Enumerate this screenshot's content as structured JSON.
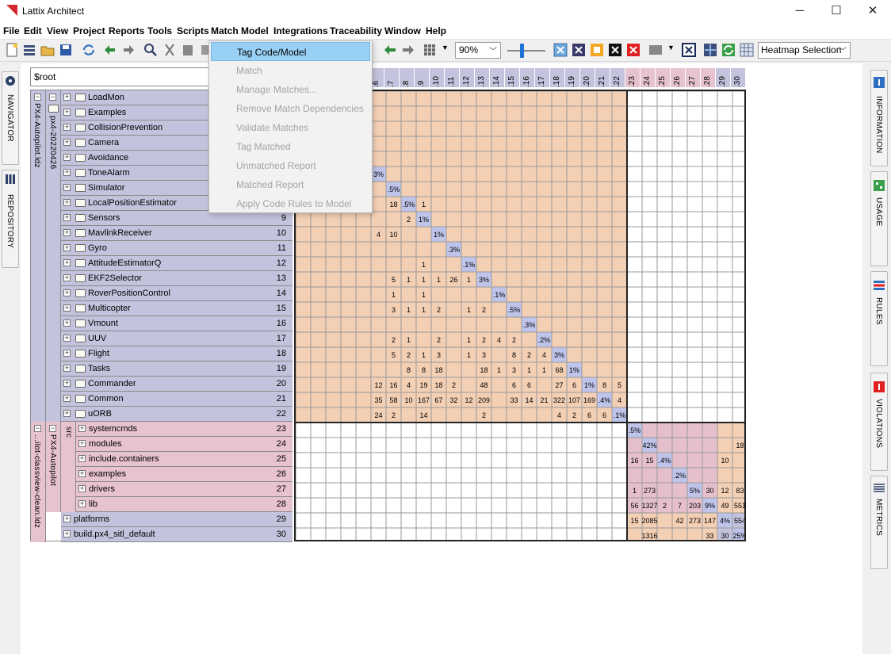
{
  "window": {
    "title": "Lattix Architect",
    "minimize": "─",
    "maximize": "☐",
    "close": "✕"
  },
  "menu": [
    "File",
    "Edit",
    "View",
    "Project",
    "Reports",
    "Tools",
    "Scripts",
    "Match Model",
    "Integrations",
    "Traceability",
    "Window",
    "Help"
  ],
  "toolbar": {
    "zoom_value": "90%",
    "heatmap_value": "Heatmap Selection"
  },
  "search": {
    "value": "$root"
  },
  "left_tabs": [
    "NAVIGATOR",
    "REPOSITORY"
  ],
  "right_tabs": [
    "INFORMATION",
    "USAGE",
    "RULES",
    "VIOLATIONS",
    "METRICS"
  ],
  "dropdown": {
    "items": [
      {
        "label": "Tag Code/Model",
        "enabled": true
      },
      {
        "label": "Match",
        "enabled": false
      },
      {
        "label": "Manage Matches...",
        "enabled": false
      },
      {
        "label": "Remove Match Dependencies",
        "enabled": false
      },
      {
        "label": "Validate Matches",
        "enabled": false
      },
      {
        "label": "Tag Matched",
        "enabled": false
      },
      {
        "label": "Unmatched Report",
        "enabled": false
      },
      {
        "label": "Matched Report",
        "enabled": false
      },
      {
        "label": "Apply Code Rules to Model",
        "enabled": false
      }
    ]
  },
  "groups": [
    {
      "label": "PX4-Autopilot.ldz"
    },
    {
      "label": "px4-20220426"
    },
    {
      "label": "...ilot-classview-clean.ldz"
    },
    {
      "label": "PX4-Autopilot"
    },
    {
      "label": "src"
    }
  ],
  "rows": [
    {
      "name": "LoadMon",
      "num": "1"
    },
    {
      "name": "Examples",
      "num": "2"
    },
    {
      "name": "CollisionPrevention",
      "num": "3"
    },
    {
      "name": "Camera",
      "num": "4"
    },
    {
      "name": "Avoidance",
      "num": "5"
    },
    {
      "name": "ToneAlarm",
      "num": "6"
    },
    {
      "name": "Simulator",
      "num": "7"
    },
    {
      "name": "LocalPositionEstimator",
      "num": "8"
    },
    {
      "name": "Sensors",
      "num": "9"
    },
    {
      "name": "MavlinkReceiver",
      "num": "10"
    },
    {
      "name": "Gyro",
      "num": "11"
    },
    {
      "name": "AttitudeEstimatorQ",
      "num": "12"
    },
    {
      "name": "EKF2Selector",
      "num": "13"
    },
    {
      "name": "RoverPositionControl",
      "num": "14"
    },
    {
      "name": "Multicopter",
      "num": "15"
    },
    {
      "name": "Vmount",
      "num": "16"
    },
    {
      "name": "UUV",
      "num": "17"
    },
    {
      "name": "Flight",
      "num": "18"
    },
    {
      "name": "Tasks",
      "num": "19"
    },
    {
      "name": "Commander",
      "num": "20"
    },
    {
      "name": "Common",
      "num": "21"
    },
    {
      "name": "uORB",
      "num": "22"
    },
    {
      "name": "systemcmds",
      "num": "23"
    },
    {
      "name": "modules",
      "num": "24"
    },
    {
      "name": "include.containers",
      "num": "25"
    },
    {
      "name": "examples",
      "num": "26"
    },
    {
      "name": "drivers",
      "num": "27"
    },
    {
      "name": "lib",
      "num": "28"
    },
    {
      "name": "platforms",
      "num": "29"
    },
    {
      "name": "build.px4_sitl_default",
      "num": "30"
    }
  ],
  "col_headers": [
    ".6",
    ".7",
    ".8",
    ".9",
    ".10",
    ".11",
    ".12",
    ".13",
    ".14",
    ".15",
    ".16",
    ".17",
    ".18",
    ".19",
    ".20",
    ".21",
    ".22",
    ".23",
    ".24",
    ".25",
    ".26",
    ".27",
    ".28",
    ".29",
    ".30"
  ],
  "colors": {
    "orange_block": "#f3cfb4",
    "purple_block": "#c3c3dd",
    "pink_block": "#e5c0cc",
    "diag": "#bfc5ea",
    "group1": "#c3c3dd",
    "group2": "#e7c2cf",
    "selected_menu": "#99d1f6"
  },
  "cells": [
    [
      6,
      6,
      "3%"
    ],
    [
      7,
      7,
      ".5%"
    ],
    [
      8,
      7,
      "18"
    ],
    [
      8,
      8,
      ".5%"
    ],
    [
      8,
      9,
      "1"
    ],
    [
      9,
      8,
      "2"
    ],
    [
      9,
      9,
      "1%"
    ],
    [
      10,
      6,
      "4"
    ],
    [
      10,
      7,
      "10"
    ],
    [
      10,
      10,
      "1%"
    ],
    [
      11,
      11,
      ".3%"
    ],
    [
      12,
      9,
      "1"
    ],
    [
      12,
      12,
      ".1%"
    ],
    [
      13,
      7,
      "5"
    ],
    [
      13,
      8,
      "1"
    ],
    [
      13,
      9,
      "1"
    ],
    [
      13,
      10,
      "1"
    ],
    [
      13,
      11,
      "26"
    ],
    [
      13,
      12,
      "1"
    ],
    [
      13,
      13,
      "3%"
    ],
    [
      14,
      7,
      "1"
    ],
    [
      14,
      9,
      "1"
    ],
    [
      14,
      14,
      ".1%"
    ],
    [
      15,
      7,
      "3"
    ],
    [
      15,
      8,
      "1"
    ],
    [
      15,
      9,
      "1"
    ],
    [
      15,
      10,
      "2"
    ],
    [
      15,
      12,
      "1"
    ],
    [
      15,
      13,
      "2"
    ],
    [
      15,
      15,
      ".5%"
    ],
    [
      16,
      16,
      ".3%"
    ],
    [
      17,
      7,
      "2"
    ],
    [
      17,
      8,
      "1"
    ],
    [
      17,
      10,
      "2"
    ],
    [
      17,
      12,
      "1"
    ],
    [
      17,
      13,
      "2"
    ],
    [
      17,
      14,
      "4"
    ],
    [
      17,
      15,
      "2"
    ],
    [
      17,
      17,
      ".2%"
    ],
    [
      18,
      7,
      "5"
    ],
    [
      18,
      8,
      "2"
    ],
    [
      18,
      9,
      "1"
    ],
    [
      18,
      10,
      "3"
    ],
    [
      18,
      12,
      "1"
    ],
    [
      18,
      13,
      "3"
    ],
    [
      18,
      15,
      "8"
    ],
    [
      18,
      16,
      "2"
    ],
    [
      18,
      17,
      "4"
    ],
    [
      18,
      18,
      "3%"
    ],
    [
      19,
      8,
      "8"
    ],
    [
      19,
      9,
      "8"
    ],
    [
      19,
      10,
      "18"
    ],
    [
      19,
      13,
      "18"
    ],
    [
      19,
      14,
      "1"
    ],
    [
      19,
      15,
      "3"
    ],
    [
      19,
      16,
      "1"
    ],
    [
      19,
      17,
      "1"
    ],
    [
      19,
      18,
      "68"
    ],
    [
      19,
      19,
      "1%"
    ],
    [
      20,
      6,
      "12"
    ],
    [
      20,
      7,
      "16"
    ],
    [
      20,
      8,
      "4"
    ],
    [
      20,
      9,
      "19"
    ],
    [
      20,
      10,
      "18"
    ],
    [
      20,
      11,
      "2"
    ],
    [
      20,
      13,
      "48"
    ],
    [
      20,
      15,
      "6"
    ],
    [
      20,
      16,
      "6"
    ],
    [
      20,
      18,
      "27"
    ],
    [
      20,
      19,
      "6"
    ],
    [
      20,
      20,
      "1%"
    ],
    [
      20,
      21,
      "8"
    ],
    [
      20,
      22,
      "5"
    ],
    [
      21,
      6,
      "35"
    ],
    [
      21,
      7,
      "58"
    ],
    [
      21,
      8,
      "10"
    ],
    [
      21,
      9,
      "167"
    ],
    [
      21,
      10,
      "67"
    ],
    [
      21,
      11,
      "32"
    ],
    [
      21,
      12,
      "12"
    ],
    [
      21,
      13,
      "209"
    ],
    [
      21,
      15,
      "33"
    ],
    [
      21,
      16,
      "14"
    ],
    [
      21,
      17,
      "21"
    ],
    [
      21,
      18,
      "322"
    ],
    [
      21,
      19,
      "107"
    ],
    [
      21,
      20,
      "169"
    ],
    [
      21,
      21,
      ".4%"
    ],
    [
      21,
      22,
      "4"
    ],
    [
      22,
      6,
      "24"
    ],
    [
      22,
      7,
      "2"
    ],
    [
      22,
      9,
      "14"
    ],
    [
      22,
      13,
      "2"
    ],
    [
      22,
      18,
      "4"
    ],
    [
      22,
      19,
      "2"
    ],
    [
      22,
      20,
      "6"
    ],
    [
      22,
      21,
      "6"
    ],
    [
      22,
      22,
      ".1%"
    ],
    [
      23,
      23,
      ".5%"
    ],
    [
      24,
      24,
      "42%"
    ],
    [
      24,
      30,
      "18"
    ],
    [
      25,
      23,
      "16"
    ],
    [
      25,
      24,
      "15"
    ],
    [
      25,
      25,
      ".4%"
    ],
    [
      25,
      29,
      "10"
    ],
    [
      26,
      26,
      ".2%"
    ],
    [
      27,
      23,
      "1"
    ],
    [
      27,
      24,
      "273"
    ],
    [
      27,
      27,
      "5%"
    ],
    [
      27,
      28,
      "30"
    ],
    [
      27,
      29,
      "12"
    ],
    [
      27,
      30,
      "83"
    ],
    [
      28,
      23,
      "56"
    ],
    [
      28,
      24,
      "1327"
    ],
    [
      28,
      25,
      "2"
    ],
    [
      28,
      26,
      "7"
    ],
    [
      28,
      27,
      "203"
    ],
    [
      28,
      28,
      "9%"
    ],
    [
      28,
      29,
      "49"
    ],
    [
      28,
      30,
      "551"
    ],
    [
      29,
      23,
      "15"
    ],
    [
      29,
      24,
      "2085"
    ],
    [
      29,
      26,
      "42"
    ],
    [
      29,
      27,
      "273"
    ],
    [
      29,
      28,
      "147"
    ],
    [
      29,
      29,
      "4%"
    ],
    [
      29,
      30,
      "554"
    ],
    [
      30,
      24,
      "1316"
    ],
    [
      30,
      28,
      "33"
    ],
    [
      30,
      29,
      "30"
    ],
    [
      30,
      30,
      "25%"
    ]
  ]
}
